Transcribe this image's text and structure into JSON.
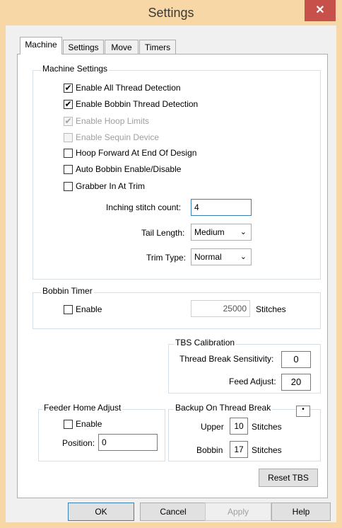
{
  "window": {
    "title": "Settings",
    "close_glyph": "✕"
  },
  "tabs": [
    {
      "label": "Machine"
    },
    {
      "label": "Settings"
    },
    {
      "label": "Move"
    },
    {
      "label": "Timers"
    }
  ],
  "machine_settings": {
    "group_label": "Machine Settings",
    "checkboxes": [
      {
        "label": "Enable All Thread Detection",
        "checked": true,
        "enabled": true
      },
      {
        "label": "Enable Bobbin Thread Detection",
        "checked": true,
        "enabled": true
      },
      {
        "label": "Enable Hoop Limits",
        "checked": true,
        "enabled": false
      },
      {
        "label": "Enable Sequin Device",
        "checked": false,
        "enabled": false
      },
      {
        "label": "Hoop Forward At End Of Design",
        "checked": false,
        "enabled": true
      },
      {
        "label": "Auto Bobbin Enable/Disable",
        "checked": false,
        "enabled": true
      },
      {
        "label": "Grabber In At Trim",
        "checked": false,
        "enabled": true
      }
    ],
    "inching_label": "Inching stitch count:",
    "inching_value": "4",
    "tail_label": "Tail Length:",
    "tail_value": "Medium",
    "trim_label": "Trim Type:",
    "trim_value": "Normal"
  },
  "bobbin_timer": {
    "group_label": "Bobbin Timer",
    "enable_label": "Enable",
    "value": "25000",
    "units": "Stitches"
  },
  "tbs_calibration": {
    "group_label": "TBS Calibration",
    "sensitivity_label": "Thread Break Sensitivity:",
    "sensitivity_value": "0",
    "feed_label": "Feed Adjust:",
    "feed_value": "20"
  },
  "feeder_home": {
    "group_label": "Feeder Home Adjust",
    "enable_label": "Enable",
    "position_label": "Position:",
    "position_value": "0"
  },
  "backup": {
    "group_label": "Backup On Thread Break",
    "upper_label": "Upper",
    "upper_value": "10",
    "upper_units": "Stitches",
    "bobbin_label": "Bobbin",
    "bobbin_value": "17",
    "bobbin_units": "Stitches",
    "spinner_glyph": "•"
  },
  "buttons": {
    "reset_tbs": "Reset TBS",
    "ok": "OK",
    "cancel": "Cancel",
    "apply": "Apply",
    "help": "Help"
  },
  "colors": {
    "titlebar": "#f6d7a5",
    "close": "#c7504b"
  }
}
